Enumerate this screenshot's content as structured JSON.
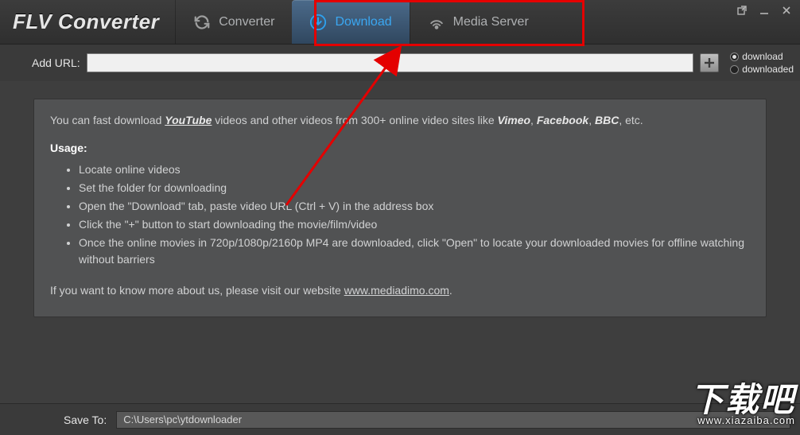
{
  "app": {
    "title": "FLV Converter"
  },
  "tabs": {
    "converter": "Converter",
    "download": "Download",
    "mediaServer": "Media Server"
  },
  "url": {
    "label": "Add URL:",
    "value": "",
    "placeholder": ""
  },
  "filters": {
    "download": "download",
    "downloaded": "downloaded"
  },
  "info": {
    "intro_pre": "You can fast download ",
    "youtube": "YouTube",
    "intro_mid": " videos and other videos from 300+ online video sites like ",
    "vimeo": "Vimeo",
    "comma": ", ",
    "facebook": "Facebook",
    "bbc": "BBC",
    "intro_end": ", etc.",
    "usage_h": "Usage:",
    "steps": [
      "Locate online videos",
      "Set the folder for downloading",
      "Open the \"Download\" tab, paste video URL (Ctrl + V) in the address box",
      "Click the \"+\" button to start downloading the movie/film/video",
      "Once the online movies in 720p/1080p/2160p MP4 are downloaded, click \"Open\" to locate your downloaded movies for offline watching without barriers"
    ],
    "more_pre": "If you want to know more about us, please visit our website ",
    "more_link": "www.mediadimo.com",
    "more_post": "."
  },
  "save": {
    "label": "Save To:",
    "path": "C:\\Users\\pc\\ytdownloader"
  },
  "watermark": {
    "big": "下载吧",
    "small": "www.xiazaiba.com"
  }
}
